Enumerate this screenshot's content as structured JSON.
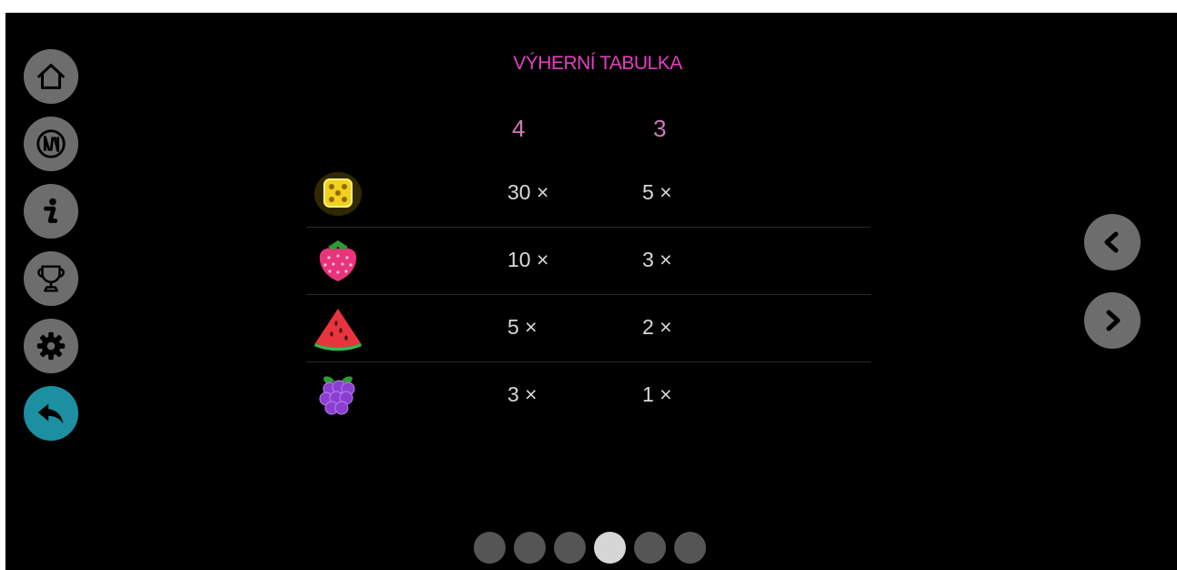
{
  "title": "VÝHERNÍ TABULKA",
  "columns": [
    "4",
    "3"
  ],
  "rows": [
    {
      "symbol": "gold-dice-icon",
      "values": [
        "30 ×",
        "5 ×"
      ]
    },
    {
      "symbol": "strawberry-icon",
      "values": [
        "10 ×",
        "3 ×"
      ]
    },
    {
      "symbol": "watermelon-icon",
      "values": [
        "5 ×",
        "2 ×"
      ]
    },
    {
      "symbol": "blackberry-icon",
      "values": [
        "3 ×",
        "1 ×"
      ]
    }
  ],
  "menu": [
    {
      "icon": "home-icon"
    },
    {
      "icon": "game-logo-icon"
    },
    {
      "icon": "info-icon"
    },
    {
      "icon": "trophy-icon"
    },
    {
      "icon": "gear-icon"
    },
    {
      "icon": "back-arrow-icon",
      "active": true
    }
  ],
  "nav": {
    "prev": "chevron-left-icon",
    "next": "chevron-right-icon"
  },
  "pager": {
    "total": 6,
    "current": 4
  },
  "colors": {
    "title": "#e53ec3",
    "column_header": "#d27ab8",
    "value_text": "#d8d8d8",
    "button_bg": "#6d6d6d",
    "active_button_bg": "#1c8fa0"
  }
}
